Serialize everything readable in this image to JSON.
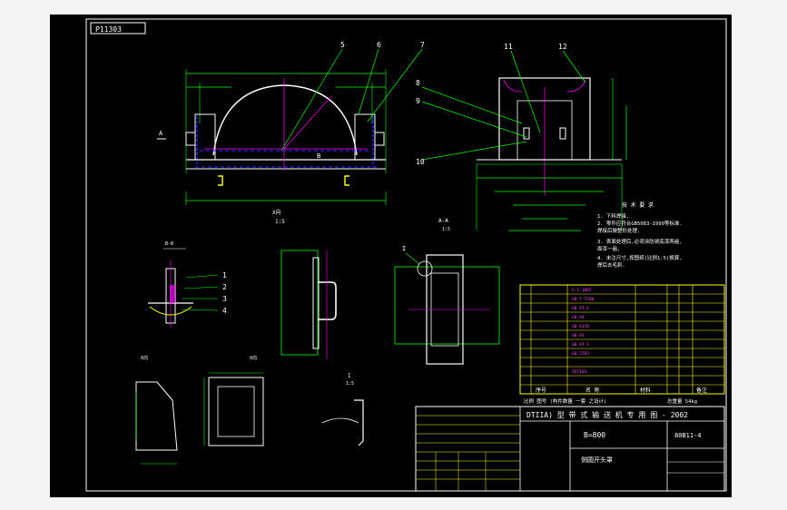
{
  "drawing": {
    "stamp": "P11303",
    "title_main": "DTIIA) 型  带 式 输 送 机 专 用 图 - 2002",
    "spec": "B=800",
    "drawing_no": "80B11-4",
    "part_name": "侧圆开头罩",
    "parts_header": [
      "序号",
      "名  称",
      "材料",
      "备注"
    ],
    "footer_left": "比例  图号  (构件数量 一套 之设计)",
    "footer_right": "总重量 54kg"
  },
  "callouts": [
    "1",
    "2",
    "3",
    "4",
    "5",
    "6",
    "7",
    "8",
    "9",
    "10",
    "11",
    "12"
  ],
  "views": {
    "section_a": "A-A",
    "section_b": "B-B",
    "view_x": "X向",
    "scale": "1:5",
    "detail_i": "I",
    "section_label_a": "A",
    "section_label_b": "B"
  },
  "notes": {
    "title": "技 术 要 求",
    "lines": [
      "1. 下料焊接,",
      "2. 零件应符合GB5083-1999等标准.",
      "   焊接后做整形处理,",
      "3. 表面处理后,必须涂防锈底漆两遍,",
      "   面漆一遍,",
      "4. 未注尺寸,按图纸(比例1:5)换算,",
      "   焊后去毛刺."
    ]
  },
  "colors": {
    "frame": "#ffffff",
    "part_lines": "#ffffff",
    "centerline": "#ff00ff",
    "hidden": "#2222ff",
    "dimension": "#00ff00",
    "table": "#ffff00",
    "text_mag": "#ff44ff",
    "leader": "#00ff00"
  }
}
